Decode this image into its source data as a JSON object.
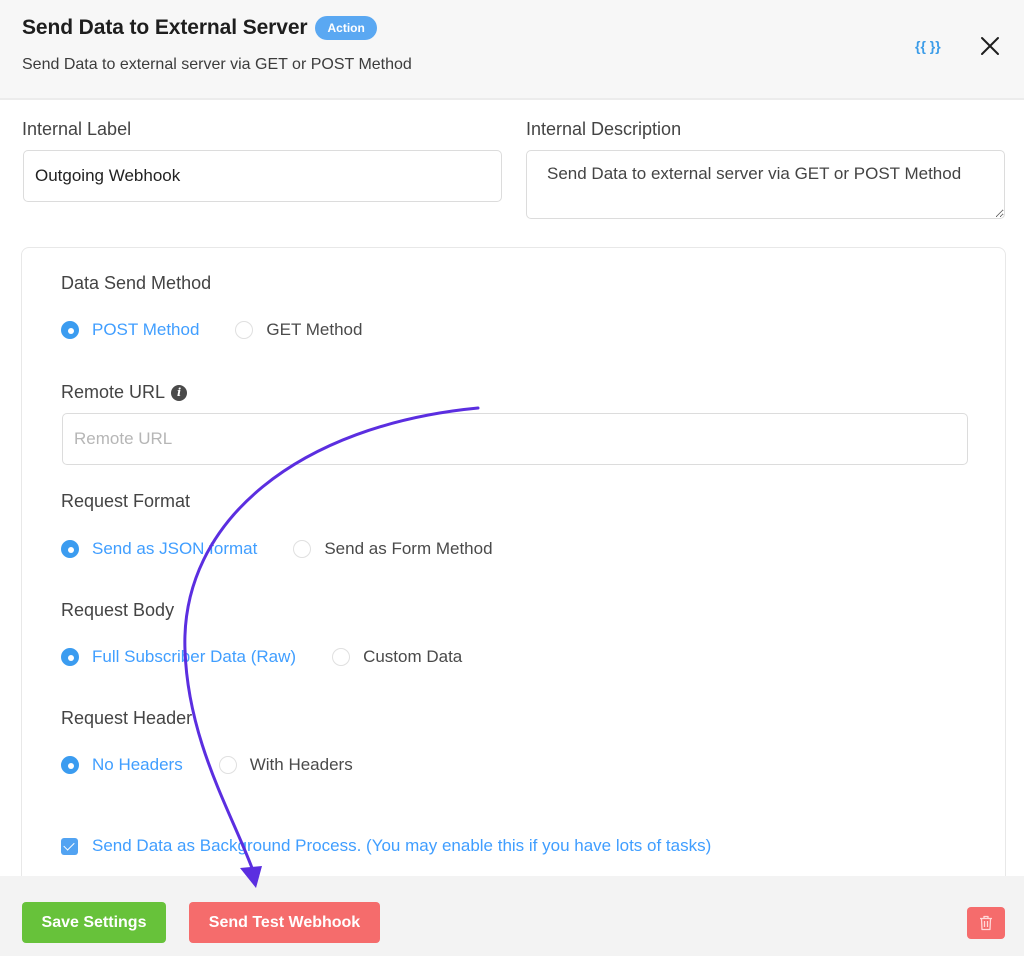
{
  "header": {
    "title": "Send Data to External Server",
    "badge": "Action",
    "subtitle": "Send Data to external server via GET or POST Method",
    "smartcode_icon": "{{ }}",
    "icons": {
      "smartcode": "smartcode-braces-icon",
      "close": "close-x-icon"
    }
  },
  "fields": {
    "internal_label": {
      "label": "Internal Label",
      "value": "Outgoing Webhook"
    },
    "internal_description": {
      "label": "Internal Description",
      "value": "Send Data to external server via GET or POST Method"
    }
  },
  "settings": {
    "data_send_method": {
      "label": "Data Send Method",
      "options": [
        {
          "label": "POST Method",
          "checked": true
        },
        {
          "label": "GET Method",
          "checked": false
        }
      ]
    },
    "remote_url": {
      "label": "Remote URL",
      "value": "",
      "placeholder": "Remote URL",
      "info_icon": "info-icon"
    },
    "request_format": {
      "label": "Request Format",
      "options": [
        {
          "label": "Send as JSON format",
          "checked": true
        },
        {
          "label": "Send as Form Method",
          "checked": false
        }
      ]
    },
    "request_body": {
      "label": "Request Body",
      "options": [
        {
          "label": "Full Subscriber Data (Raw)",
          "checked": true
        },
        {
          "label": "Custom Data",
          "checked": false
        }
      ]
    },
    "request_header": {
      "label": "Request Header",
      "options": [
        {
          "label": "No Headers",
          "checked": true
        },
        {
          "label": "With Headers",
          "checked": false
        }
      ]
    },
    "background_process": {
      "label": "Send Data as Background Process. (You may enable this if you have lots of tasks)",
      "checked": true
    }
  },
  "footer": {
    "save_label": "Save Settings",
    "test_label": "Send Test Webhook",
    "delete_icon": "trash-icon"
  },
  "colors": {
    "accent_blue": "#409eff",
    "badge_blue": "#5aa8f2",
    "save_green": "#67c23a",
    "danger_red": "#f56c6c",
    "annotation_arrow": "#5b2ee0"
  }
}
